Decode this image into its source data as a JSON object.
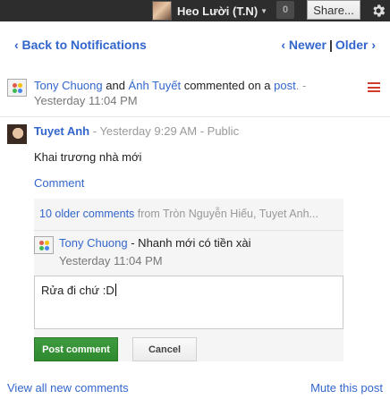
{
  "topbar": {
    "user_name": "Heo Lười (T.N)",
    "notification_count": "0",
    "share_label": "Share...",
    "gear_icon": "gear-icon"
  },
  "nav": {
    "back_label": "‹ Back to Notifications",
    "newer_label": "‹ Newer",
    "separator": "|",
    "older_label": "Older ›"
  },
  "notification": {
    "actor1": "Tony Chuong",
    "and_text": " and ",
    "actor2": "Ánh Tuyết",
    "action_text": " commented on a ",
    "target": "post",
    "trailing": ". -",
    "time": "Yesterday 11:04 PM"
  },
  "post": {
    "author": "Tuyet Anh",
    "time": "- Yesterday 9:29 AM -",
    "visibility": "Public",
    "text": "Khai trương nhà mới",
    "comment_label": "Comment"
  },
  "comments": {
    "older_label": "10 older comments",
    "older_from": " from Tròn Nguyễn Hiếu, Tuyet Anh...",
    "items": [
      {
        "author": "Tony Chuong",
        "text": " - Nhanh mới có tiền xài",
        "time": "Yesterday 11:04 PM"
      }
    ],
    "reply_value": "Rửa đi chứ :D",
    "post_button": "Post comment",
    "cancel_button": "Cancel"
  },
  "footer": {
    "view_all": "View all new comments",
    "mute": "Mute this post"
  },
  "colors": {
    "link": "#3366cc",
    "topbar": "#2d2d2d",
    "post_button": "#3f9b3f",
    "list_icon": "#d13b2b"
  }
}
